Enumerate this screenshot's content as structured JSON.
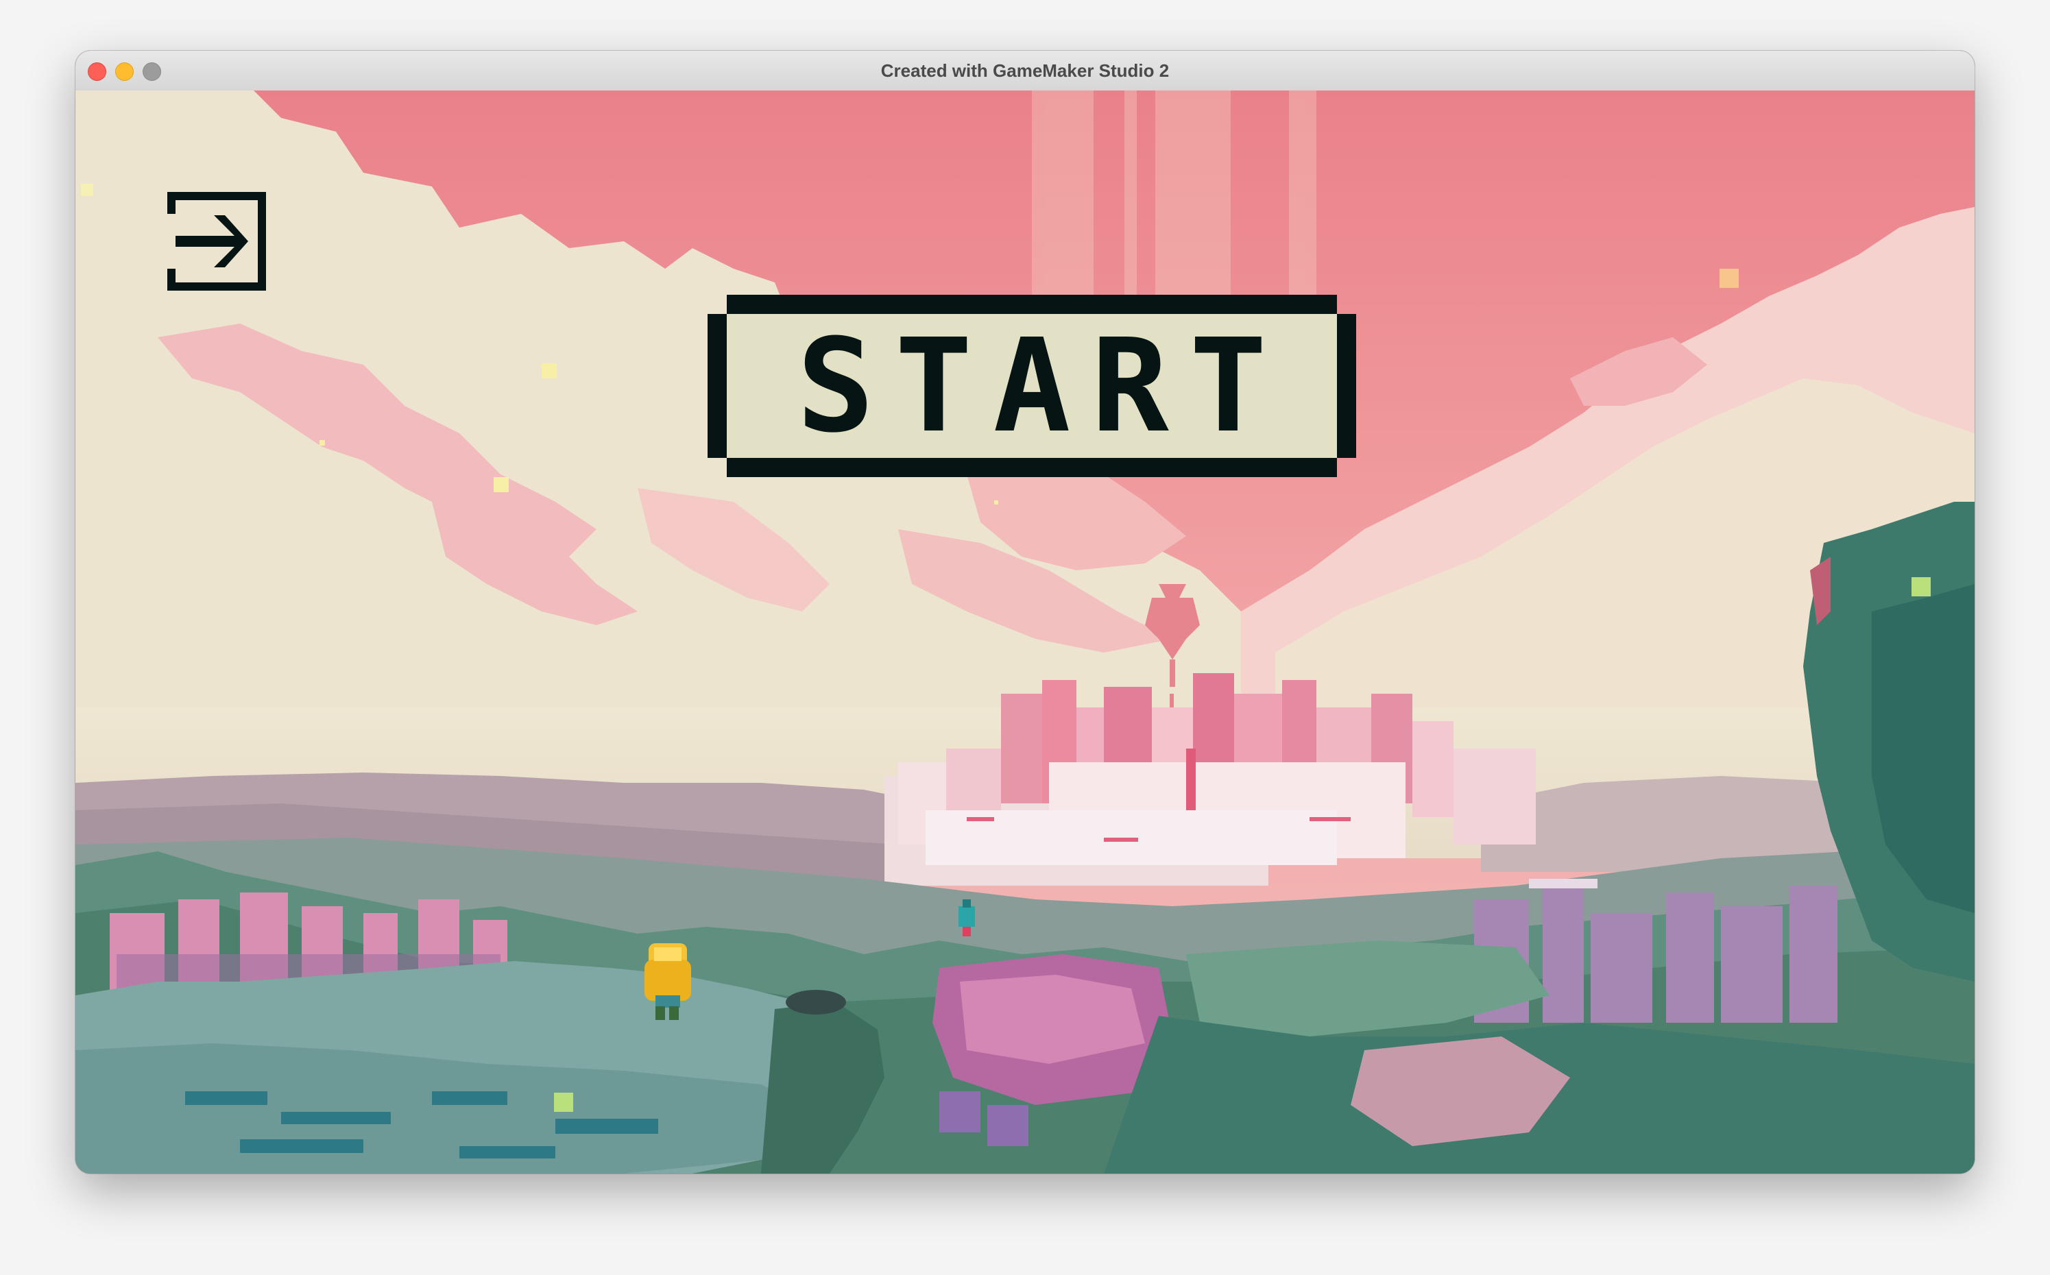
{
  "window": {
    "title": "Created with GameMaker Studio 2",
    "controls": [
      "close",
      "minimize",
      "maximize"
    ]
  },
  "menu": {
    "start_label": "START",
    "exit_icon": "exit-arrow-icon"
  },
  "colors": {
    "sky_pink": "#ee8b8f",
    "cloud_cream": "#ede3cf",
    "button_fill": "#e3e1c5",
    "button_outline": "#061514",
    "forest_green": "#3f7d6c",
    "hair_yellow": "#f4c233"
  }
}
